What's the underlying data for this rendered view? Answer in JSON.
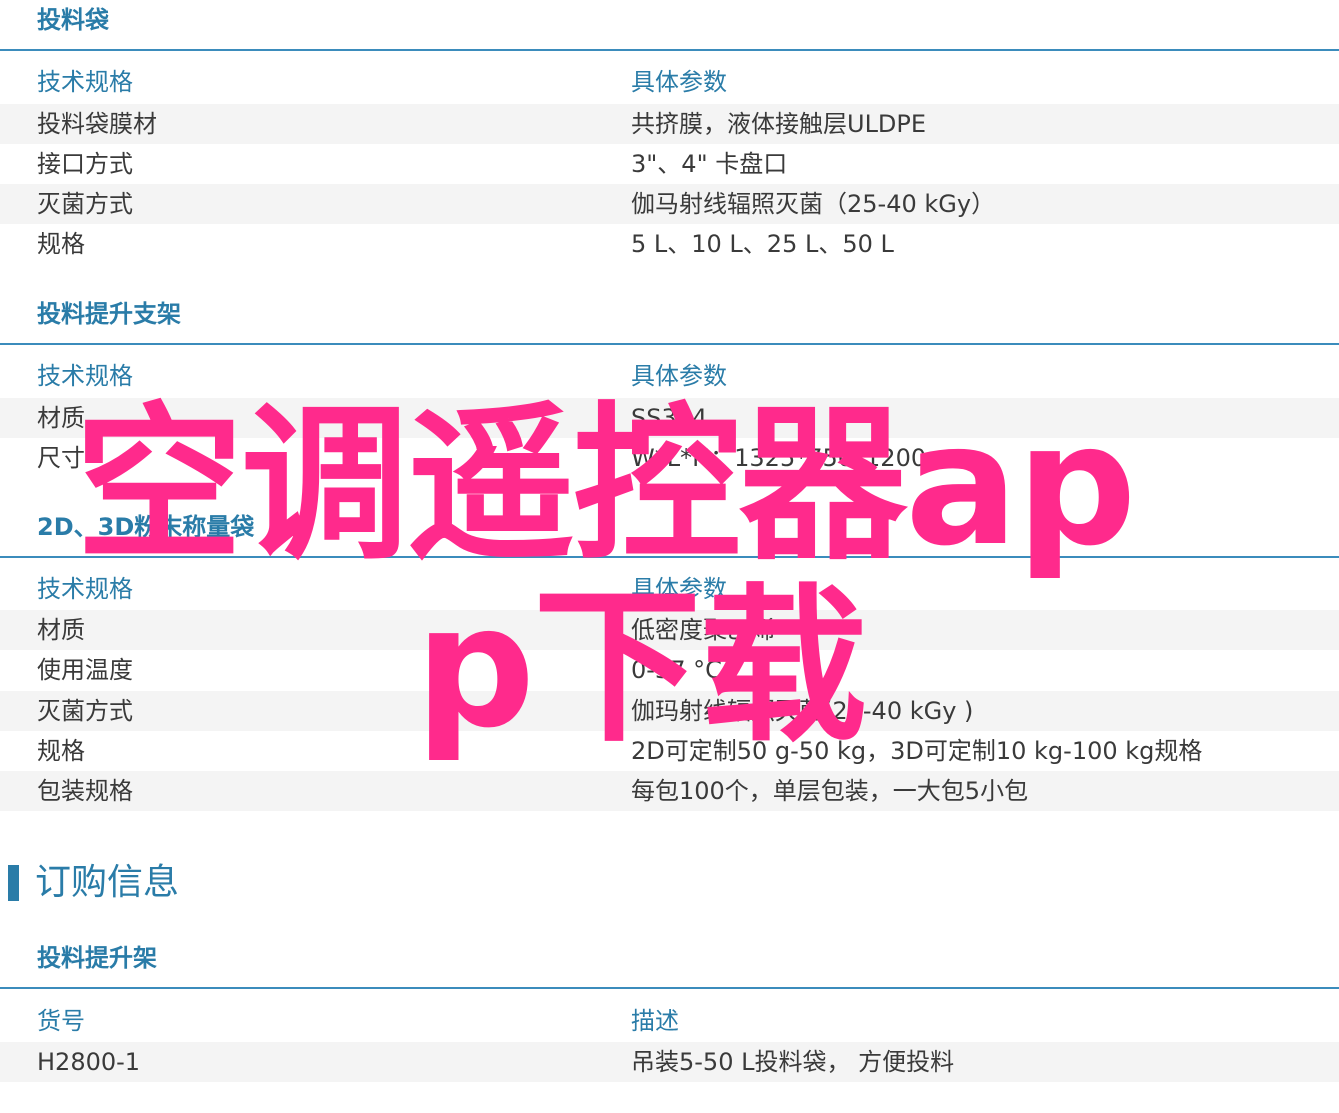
{
  "sections": [
    {
      "title": "投料袋",
      "header": [
        "技术规格",
        "具体参数"
      ],
      "rows": [
        [
          "投料袋膜材",
          "共挤膜，液体接触层ULDPE"
        ],
        [
          "接口方式",
          "3\"、4\" 卡盘口"
        ],
        [
          "灭菌方式",
          "伽马射线辐照灭菌（25-40 kGy）"
        ],
        [
          "规格",
          "5 L、10 L、25 L、50 L"
        ]
      ]
    },
    {
      "title": "投料提升支架",
      "header": [
        "技术规格",
        "具体参数"
      ],
      "rows": [
        [
          "材质",
          "SS304"
        ],
        [
          "尺寸",
          "W*L*H：1325*750*1200 mm"
        ]
      ]
    },
    {
      "title": "2D、3D粉末称量袋",
      "header": [
        "技术规格",
        "具体参数"
      ],
      "rows": [
        [
          "材质",
          "低密度聚乙烯"
        ],
        [
          "使用温度",
          "0-37 °C"
        ],
        [
          "灭菌方式",
          "伽玛射线辐照灭菌(25-40 kGy )"
        ],
        [
          "规格",
          "2D可定制50 g-50 kg，3D可定制10 kg-100 kg规格"
        ],
        [
          "包装规格",
          "每包100个，单层包装，一大包5小包"
        ]
      ]
    }
  ],
  "order": {
    "heading": "订购信息",
    "title": "投料提升架",
    "header": [
      "货号",
      "描述"
    ],
    "rows": [
      [
        "H2800-1",
        "吊装5-50 L投料袋， 方便投料"
      ]
    ]
  },
  "watermark": {
    "line1": "空调遥控器ap",
    "line2": "p下载",
    "color": "#ff2a8c"
  }
}
